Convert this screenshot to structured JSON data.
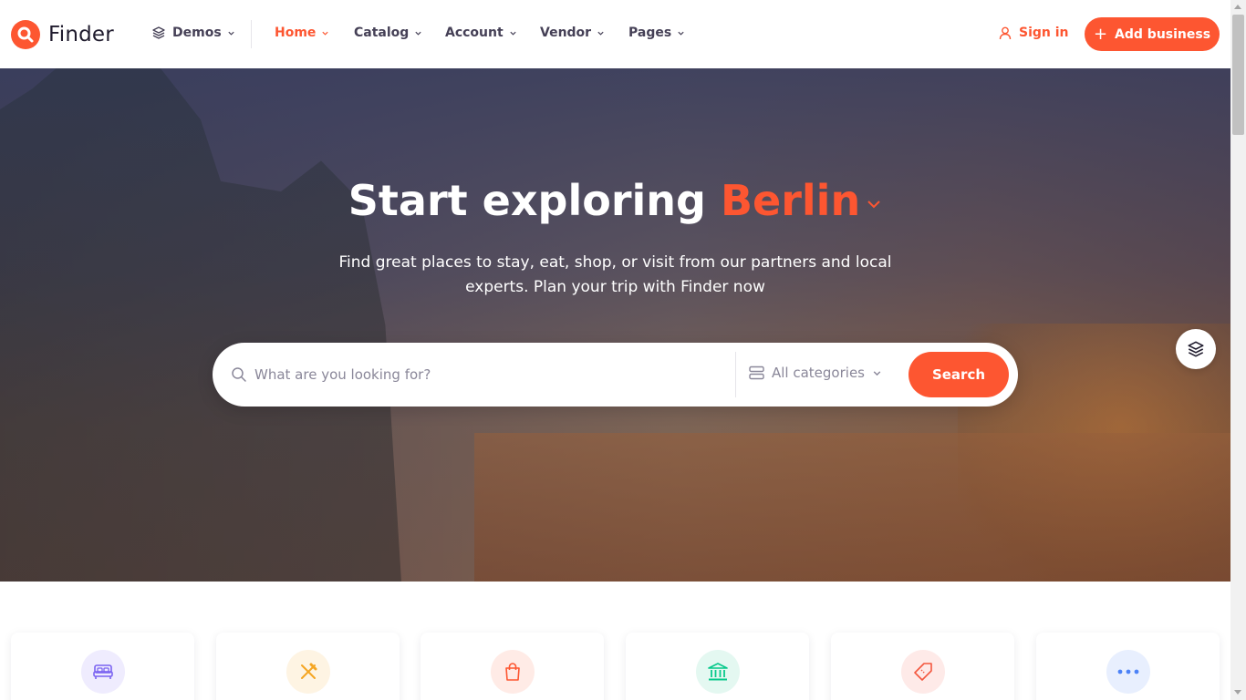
{
  "header": {
    "logo_text": "Finder",
    "nav": {
      "demos": "Demos",
      "home": "Home",
      "catalog": "Catalog",
      "account": "Account",
      "vendor": "Vendor",
      "pages": "Pages"
    },
    "sign_in": "Sign in",
    "add_business": "Add business"
  },
  "hero": {
    "title_prefix": "Start exploring",
    "city": "Berlin",
    "subtitle": "Find great places to stay, eat, shop, or visit from our partners and local experts. Plan your trip with Finder now",
    "search": {
      "placeholder": "What are you looking for?",
      "value": "",
      "category_selected": "All categories",
      "button": "Search"
    }
  },
  "categories": [
    {
      "icon": "bed-icon",
      "color": "#7a63f1",
      "bg": "#efecfe"
    },
    {
      "icon": "utensils-icon",
      "color": "#f5a623",
      "bg": "#fef4e3"
    },
    {
      "icon": "shopping-bag-icon",
      "color": "#fd5631",
      "bg": "#ffebe6"
    },
    {
      "icon": "museum-icon",
      "color": "#07c98b",
      "bg": "#e4f8f1"
    },
    {
      "icon": "ticket-icon",
      "color": "#f3573e",
      "bg": "#feeae8"
    },
    {
      "icon": "more-icon",
      "color": "#4c82f7",
      "bg": "#e8effe"
    }
  ],
  "colors": {
    "accent": "#fd5631",
    "text_dark": "#1f1b2d",
    "nav_text": "#454056"
  }
}
